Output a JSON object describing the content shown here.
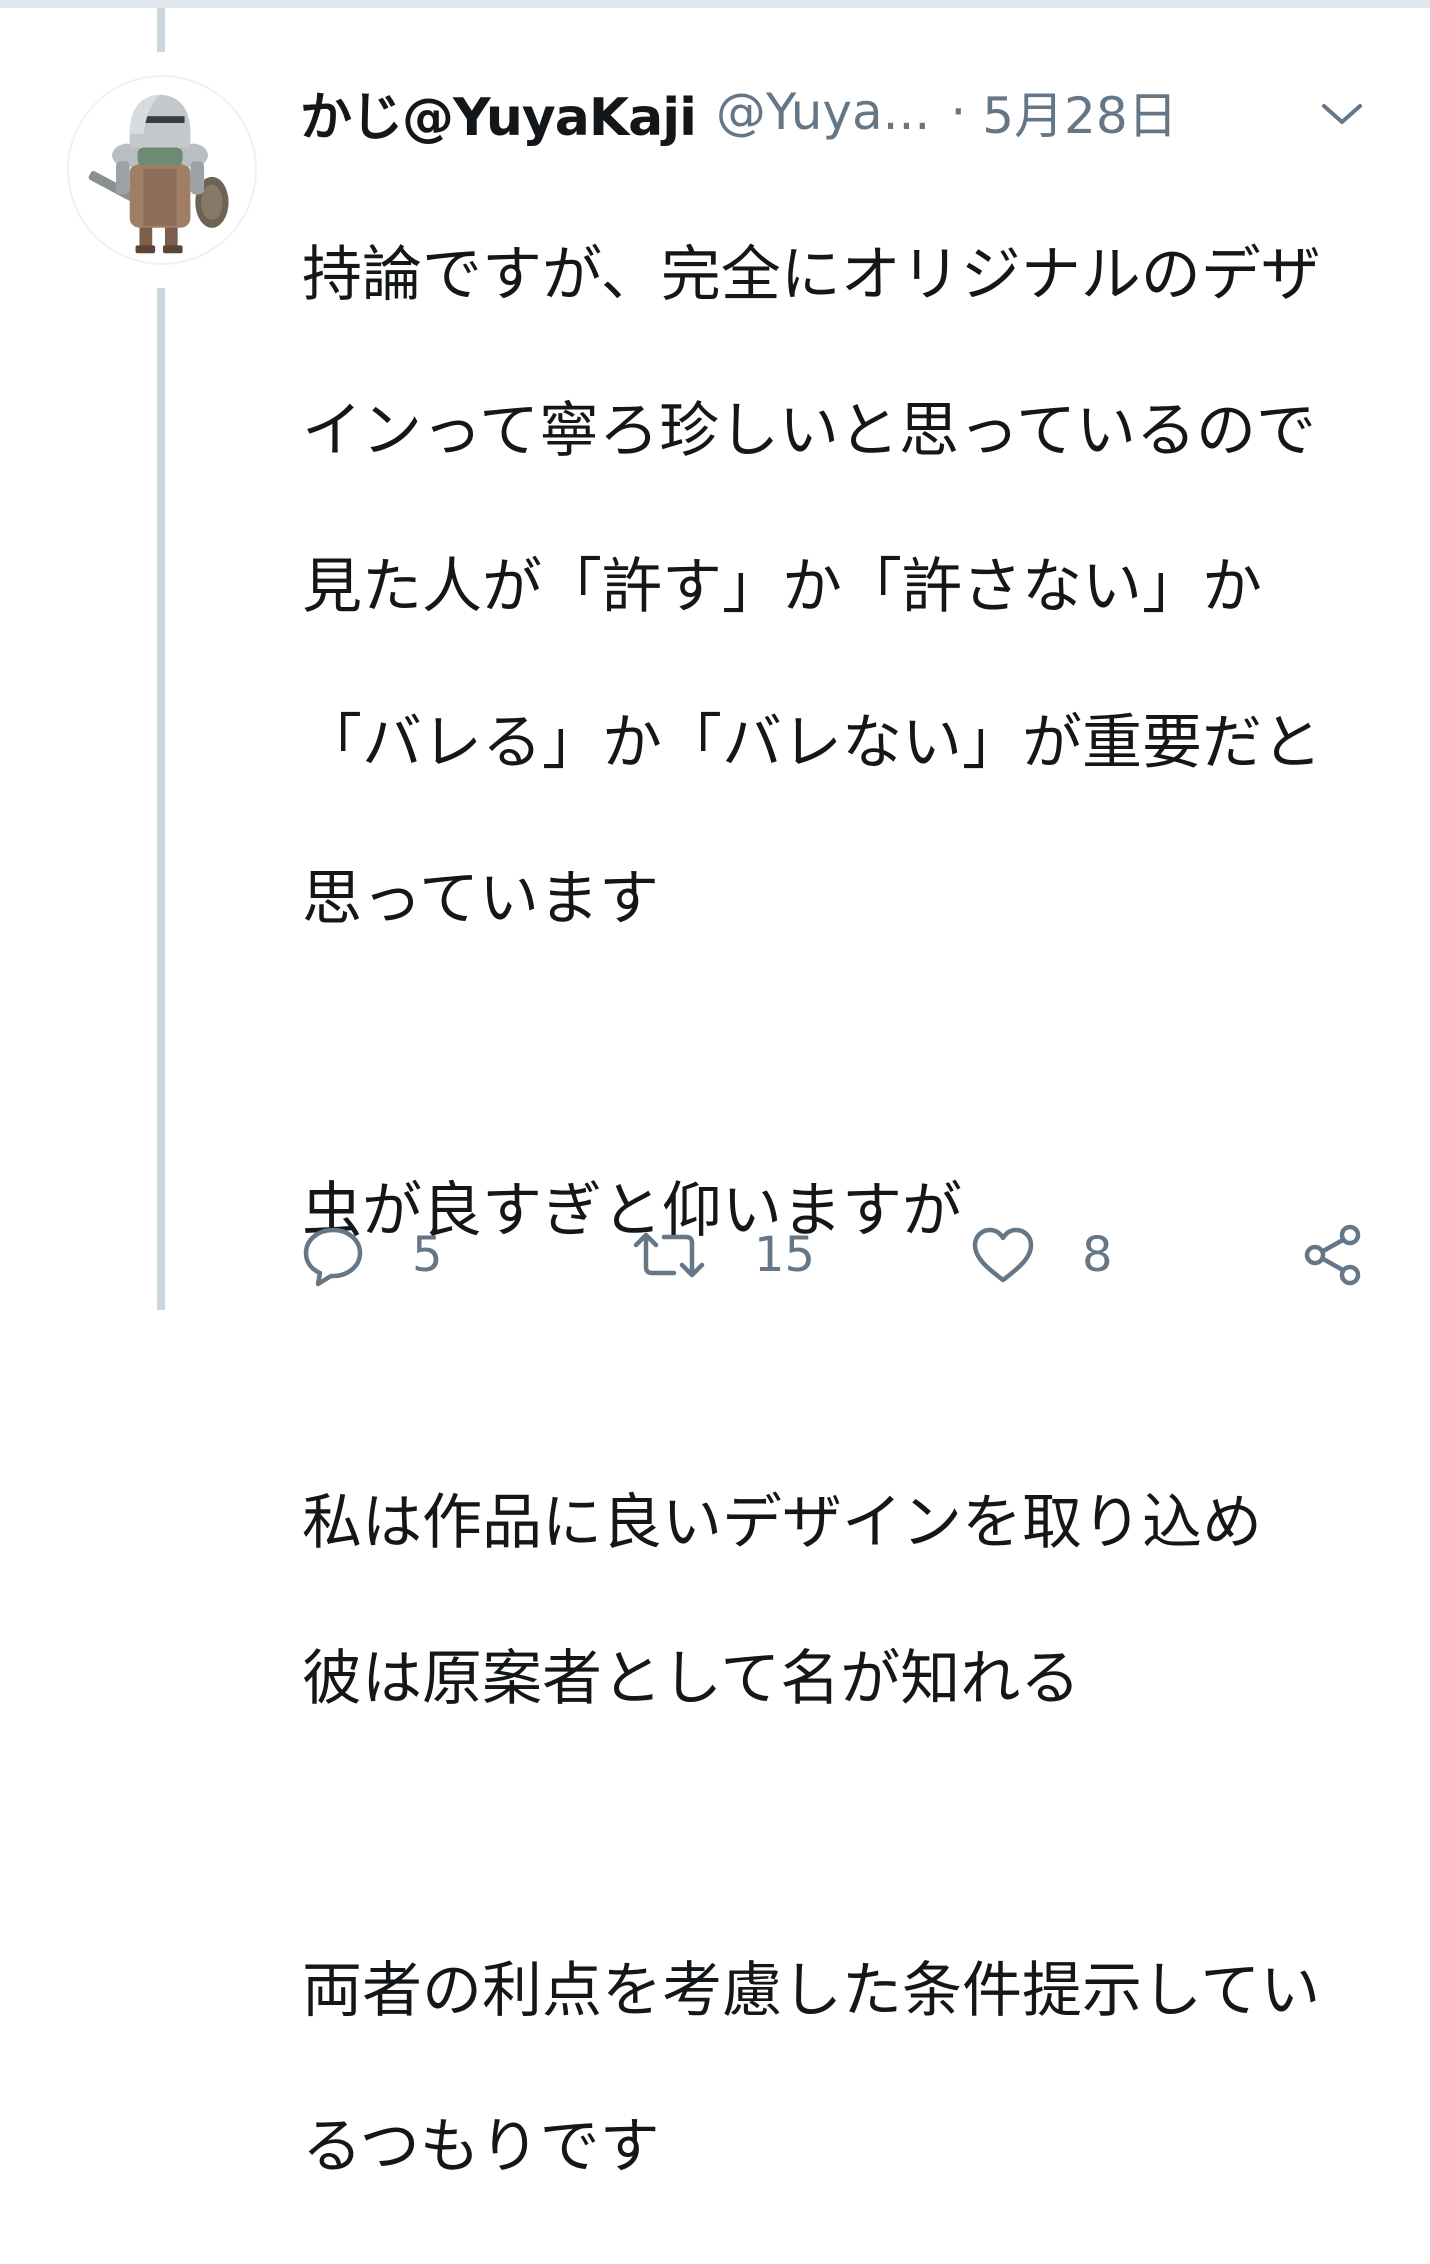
{
  "tweet": {
    "author_name": "かじ@YuyaKaji",
    "author_handle": "@Yuya...",
    "separator": "·",
    "date": "5月28日",
    "text_lines": [
      "持論ですが、完全にオリジナルのデザ",
      "インって寧ろ珍しいと思っているので",
      "見た人が「許す」か「許さない」か",
      "「バレる」か「バレない」が重要だと",
      "思っています",
      "",
      "虫が良すぎと仰いますが",
      "",
      "私は作品に良いデザインを取り込め",
      "彼は原案者として名が知れる",
      "",
      "両者の利点を考慮した条件提示してい",
      "るつもりです"
    ],
    "actions": {
      "reply": {
        "icon": "reply-icon",
        "count": "5"
      },
      "retweet": {
        "icon": "retweet-icon",
        "count": "15"
      },
      "like": {
        "icon": "heart-icon",
        "count": "8"
      },
      "share": {
        "icon": "share-icon"
      }
    },
    "menu_icon": "chevron-down-icon"
  },
  "colors": {
    "text_primary": "#14171a",
    "text_secondary": "#657786",
    "thread_line": "#ccd6dd",
    "border": "#e1e8ed"
  }
}
